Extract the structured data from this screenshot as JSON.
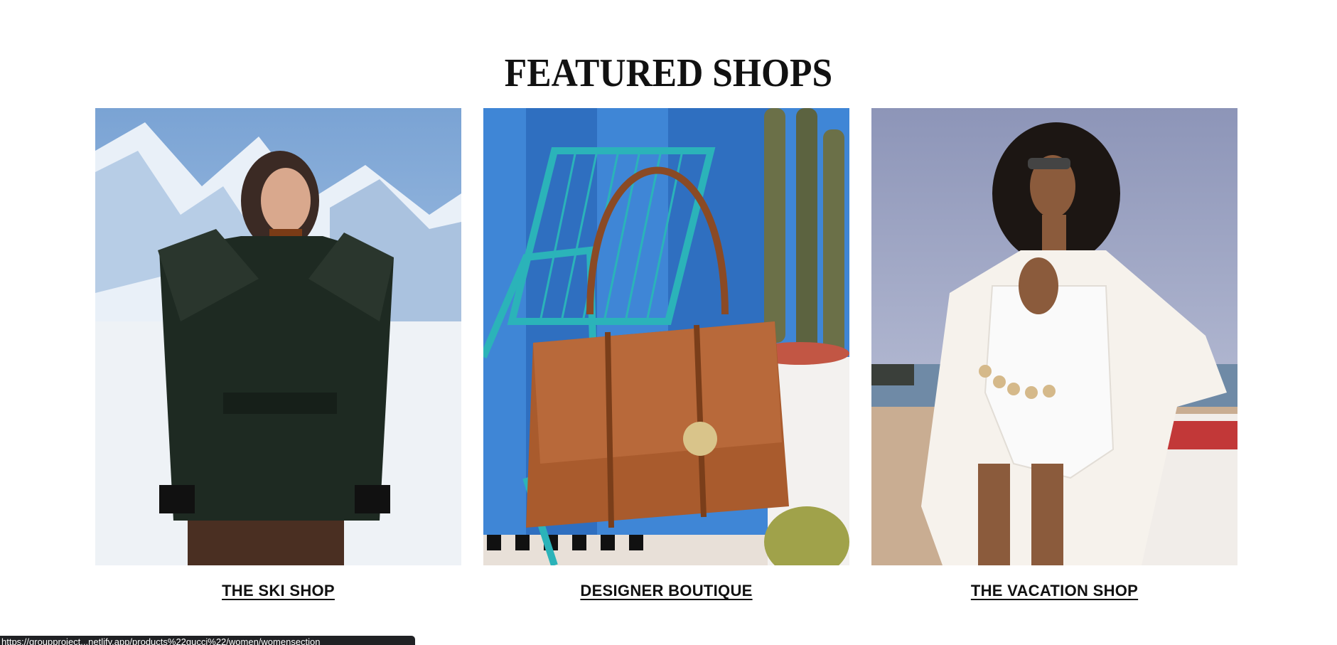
{
  "section": {
    "title": "FEATURED SHOPS"
  },
  "shops": [
    {
      "label": "THE SKI SHOP",
      "image_alt": "Model in dark green ruffle-shoulder belted jacket in front of snowy mountains"
    },
    {
      "label": "DESIGNER BOUTIQUE",
      "image_alt": "Brown leather braided handbag hanging on a teal chair beside cacti"
    },
    {
      "label": "THE VACATION SHOP",
      "image_alt": "Model in white swimsuit and sheer white shirt on a beach"
    }
  ],
  "status_bar": {
    "url": "https://groupproject...netlify.app/products%22gucci%22/women/womensection"
  }
}
